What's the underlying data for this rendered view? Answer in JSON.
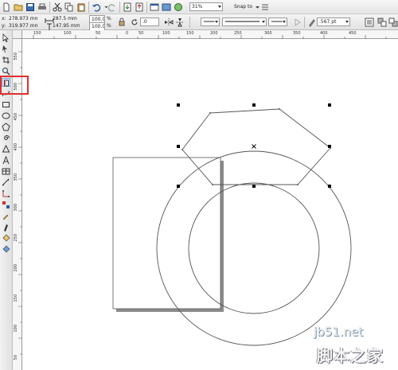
{
  "property_bar": {
    "x_label": "x:",
    "x_value": "278.973 mm",
    "y_label": "y:",
    "y_value": "319.977 mm",
    "width_value": "287.5 mm",
    "height_value": "147.95 mm",
    "scale_x": "100.0",
    "scale_y": "100.0",
    "percent_x": "%",
    "percent_y": "%",
    "rotation": ".0",
    "outline_width": ".567 pt"
  },
  "standard_bar": {
    "zoom_level": "31%",
    "snap_to_label": "Snap to"
  },
  "rulers": {
    "horizontal_ticks": [
      "150",
      "100",
      "50",
      "0",
      "50",
      "100",
      "150",
      "200",
      "250",
      "300",
      "350",
      "400",
      "450"
    ],
    "vertical_ticks": [
      "550",
      "500",
      "450",
      "400",
      "350",
      "300",
      "250",
      "200",
      "150",
      "100",
      "50"
    ]
  },
  "watermark": {
    "url": "jb51.net",
    "site_name": "脚本之家"
  },
  "colors": {
    "highlight": "#e0302c",
    "toolbar_bg": "#e8e8e8",
    "canvas_bg": "#ffffff"
  }
}
